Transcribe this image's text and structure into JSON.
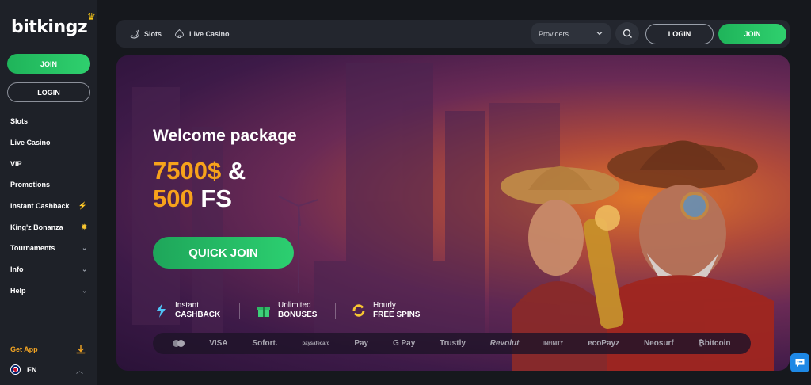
{
  "brand": {
    "logo_text": "bitkingz"
  },
  "sidebar": {
    "join_label": "JOIN",
    "login_label": "LOGIN",
    "items": [
      {
        "label": "Slots"
      },
      {
        "label": "Live Casino"
      },
      {
        "label": "VIP"
      },
      {
        "label": "Promotions"
      },
      {
        "label": "Instant Cashback",
        "icon": "lightning-icon"
      },
      {
        "label": "King'z Bonanza",
        "icon": "sun-icon"
      },
      {
        "label": "Tournaments",
        "icon": "chevron-down-icon"
      },
      {
        "label": "Info",
        "icon": "chevron-down-icon"
      },
      {
        "label": "Help",
        "icon": "chevron-down-icon"
      }
    ],
    "get_app_label": "Get App",
    "language": "EN"
  },
  "topbar": {
    "slots_label": "Slots",
    "live_casino_label": "Live Casino",
    "providers_label": "Providers",
    "login_label": "LOGIN",
    "join_label": "JOIN"
  },
  "hero": {
    "title": "Welcome package",
    "amount_gold_1": "7500$",
    "amount_white_1": " &",
    "amount_gold_2": "500",
    "amount_white_2": " FS",
    "cta_label": "QUICK JOIN",
    "features": [
      {
        "line1": "Instant",
        "line2": "CASHBACK",
        "icon": "lightning-icon"
      },
      {
        "line1": "Unlimited",
        "line2": "BONUSES",
        "icon": "gift-icon"
      },
      {
        "line1": "Hourly",
        "line2": "FREE SPINS",
        "icon": "refresh-icon"
      }
    ],
    "payments": [
      "VISA",
      "Sofort.",
      "paysafecard",
      "Pay",
      "G Pay",
      "Trustly",
      "Revolut",
      "INFINITY",
      "ecoPayz",
      "Neosurf",
      "bitcoin"
    ]
  },
  "colors": {
    "accent_green": "#2fd06e",
    "gold": "#f7a21b",
    "sidebar_bg": "#1e2128",
    "page_bg": "#16181d"
  }
}
